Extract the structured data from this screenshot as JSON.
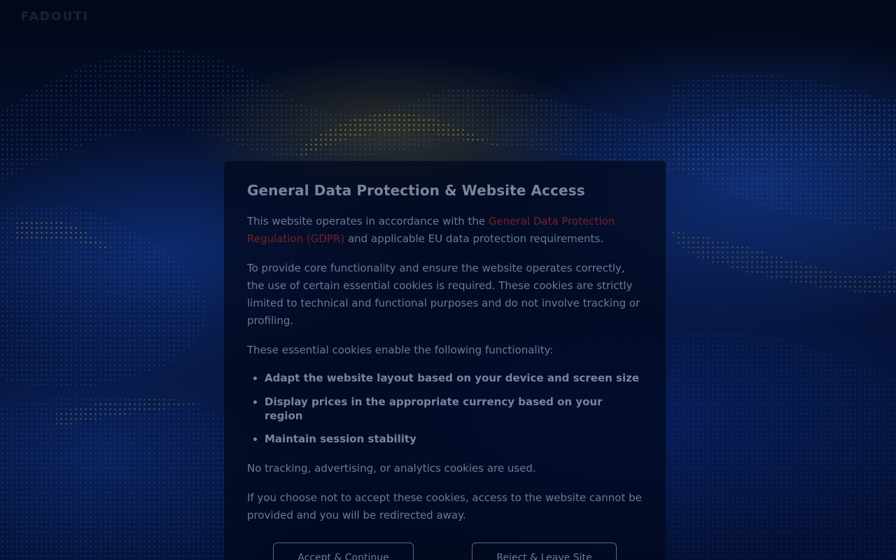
{
  "brand": {
    "logo_text": "FADOUTI"
  },
  "dialog": {
    "title": "General Data Protection & Website Access",
    "intro_before_link": "This website operates in accordance with the ",
    "gdpr_link_text": "General Data Protection Regulation (GDPR)",
    "intro_after_link": " and applicable EU data protection requirements.",
    "purpose_text": "To provide core functionality and ensure the website operates correctly, the use of certain essential cookies is required. These cookies are strictly limited to technical and functional purposes and do not involve tracking or profiling.",
    "list_intro": "These essential cookies enable the following functionality:",
    "functions": [
      "Adapt the website layout based on your device and screen size",
      "Display prices in the appropriate currency based on your region",
      "Maintain session stability"
    ],
    "no_tracking_text": "No tracking, advertising, or analytics cookies are used.",
    "consequence_text": "If you choose not to accept these cookies, access to the website cannot be provided and you will be redirected away.",
    "accept_label": "Accept & Continue",
    "reject_label": "Reject & Leave Site"
  },
  "colors": {
    "overlay": "#02081c",
    "link": "#7a1f2b",
    "text": "#6e7893"
  }
}
